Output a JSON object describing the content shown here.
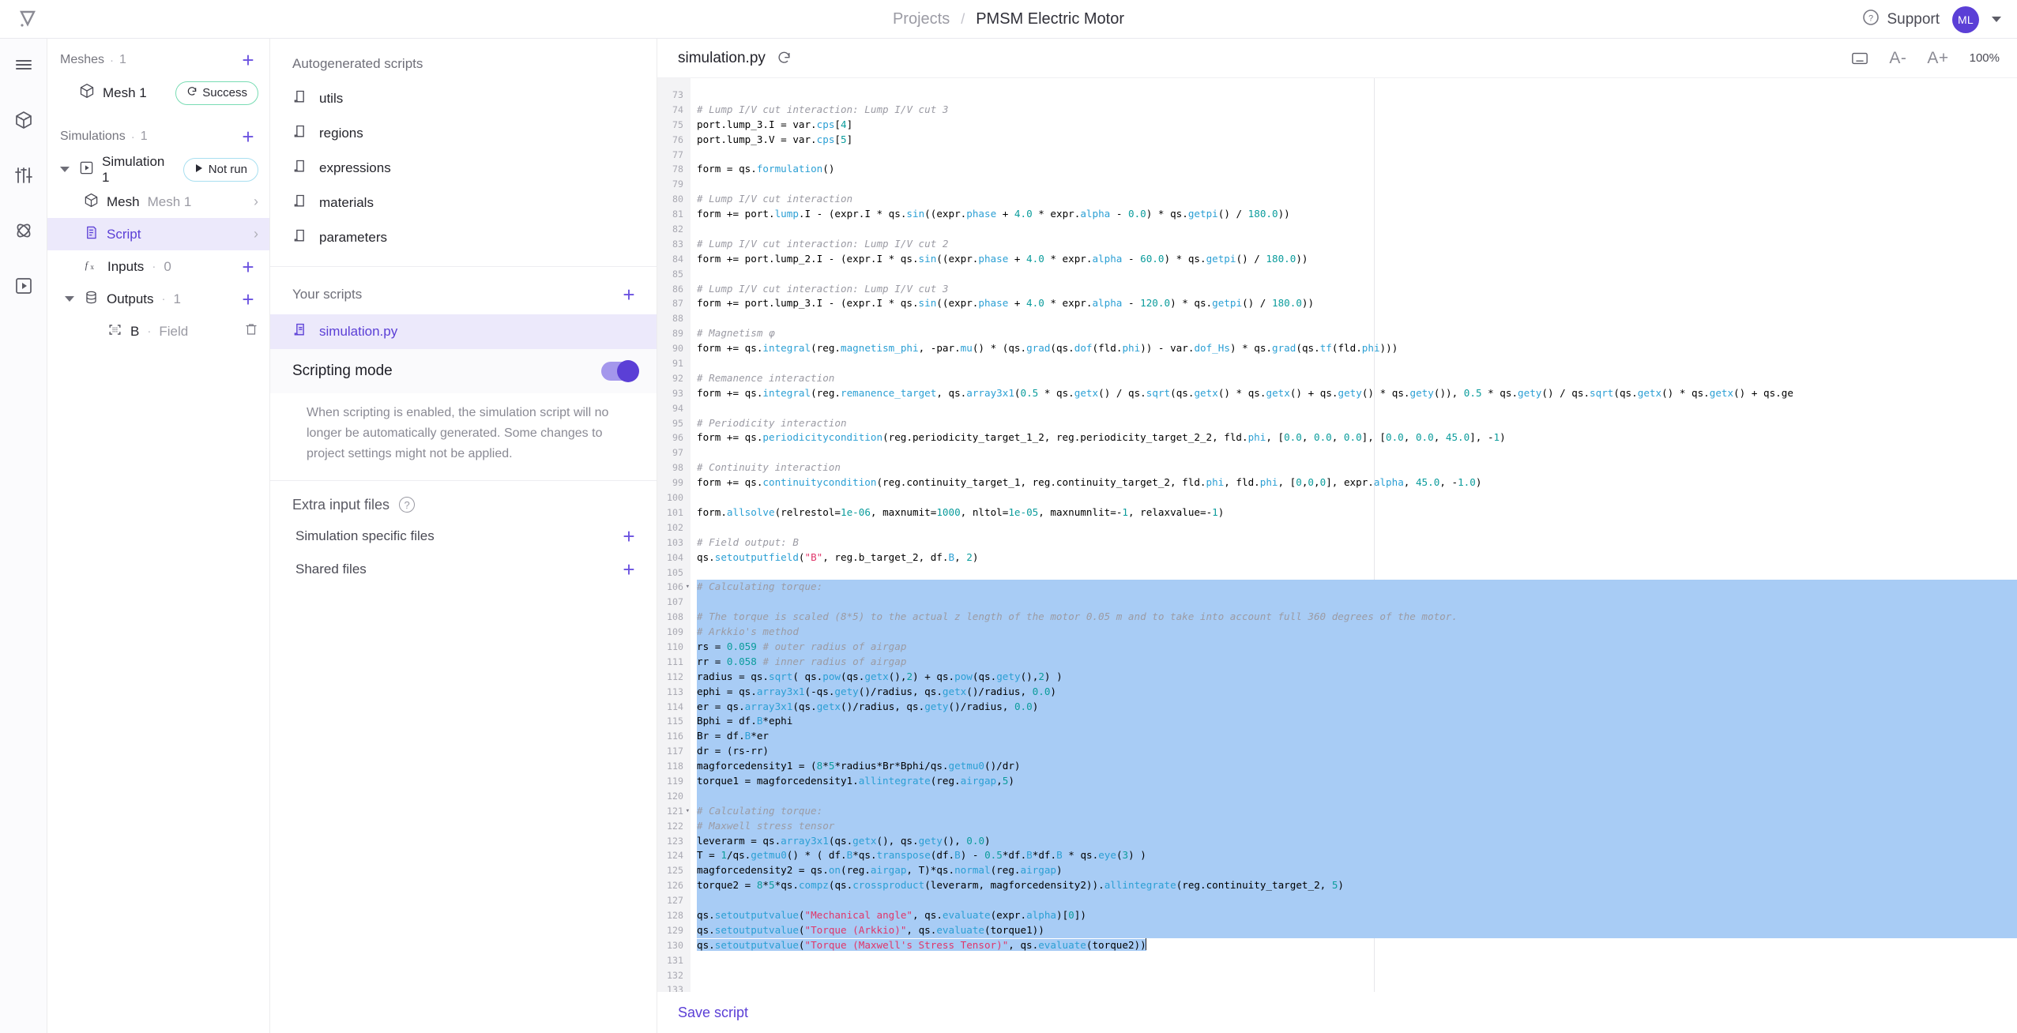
{
  "topbar": {
    "logo_icon": "quanscient-logo-icon",
    "breadcrumb": {
      "root": "Projects",
      "separator": "/",
      "current": "PMSM Electric Motor"
    },
    "support_label": "Support",
    "support_icon": "question-circle-icon",
    "avatar_initials": "ML",
    "chevron_icon": "chevron-down-icon"
  },
  "rail": {
    "items": [
      {
        "icon": "hamburger-menu-icon",
        "name": "menu"
      },
      {
        "icon": "geometry-cube-icon",
        "name": "geometry"
      },
      {
        "icon": "sliders-icon",
        "name": "physics-settings"
      },
      {
        "icon": "atom-icon",
        "name": "materials"
      },
      {
        "icon": "play-box-icon",
        "name": "simulations"
      }
    ]
  },
  "tree": {
    "meshes": {
      "label": "Meshes",
      "sep": "·",
      "count": "1",
      "add_icon": "plus-icon"
    },
    "mesh_item": {
      "icon": "cube-icon",
      "label": "Mesh 1",
      "status": "Success",
      "status_icon": "refresh-icon"
    },
    "simulations": {
      "label": "Simulations",
      "sep": "·",
      "count": "1",
      "add_icon": "plus-icon"
    },
    "simulation_item": {
      "icon": "play-box-icon",
      "label": "Simulation 1",
      "status": "Not run",
      "status_icon": "play-triangle-icon"
    },
    "children": [
      {
        "icon": "cube-icon",
        "label": "Mesh",
        "sub": "Mesh 1",
        "chevron": "chevron-right-icon",
        "selected": false
      },
      {
        "icon": "script-icon",
        "label": "Script",
        "sub": "",
        "chevron": "chevron-right-icon",
        "selected": true
      }
    ],
    "inputs": {
      "icon": "fx-icon",
      "label": "Inputs",
      "sep": "·",
      "count": "0",
      "add_icon": "plus-icon"
    },
    "outputs": {
      "icon": "database-icon",
      "label": "Outputs",
      "sep": "·",
      "count": "1",
      "add_icon": "plus-icon"
    },
    "output_items": [
      {
        "icon": "field-select-icon",
        "label": "B",
        "sep": "·",
        "type": "Field",
        "delete_icon": "trash-icon"
      }
    ]
  },
  "scripts_panel": {
    "autogen_heading": "Autogenerated scripts",
    "autogen_items": [
      {
        "icon": "script-file-icon",
        "label": "utils"
      },
      {
        "icon": "script-file-icon",
        "label": "regions"
      },
      {
        "icon": "script-file-icon",
        "label": "expressions"
      },
      {
        "icon": "script-file-icon",
        "label": "materials"
      },
      {
        "icon": "script-file-icon",
        "label": "parameters"
      }
    ],
    "your_scripts_heading": "Your scripts",
    "your_scripts_add_icon": "plus-icon",
    "your_scripts_items": [
      {
        "icon": "script-file-icon",
        "label": "simulation.py",
        "selected": true
      }
    ],
    "scripting_mode": {
      "label": "Scripting mode",
      "enabled": true,
      "description": "When scripting is enabled, the simulation script will no longer be automatically generated. Some changes to project settings might not be applied."
    },
    "extra_input_files": {
      "heading": "Extra input files",
      "help_icon": "question-circle-icon",
      "rows": [
        {
          "label": "Simulation specific files",
          "add_icon": "plus-icon"
        },
        {
          "label": "Shared files",
          "add_icon": "plus-icon"
        }
      ]
    }
  },
  "editor": {
    "file_name": "simulation.py",
    "refresh_icon": "refresh-icon",
    "keyboard_icon": "keyboard-icon",
    "font_decrease_label": "A-",
    "font_increase_label": "A+",
    "zoom_level": "100%",
    "save_label": "Save script",
    "first_line_number": 73,
    "last_line_number": 133,
    "selection_start_line": 106,
    "selection_end_line": 130,
    "fold_lines": [
      106,
      121
    ],
    "accent_color": "#5b3fd6",
    "selection_color": "#a8ccf5",
    "lines": [
      "",
      "# Lump I/V cut interaction: Lump I/V cut 3",
      "port.lump_3.I = var.cps[4]",
      "port.lump_3.V = var.cps[5]",
      "",
      "form = qs.formulation()",
      "",
      "# Lump I/V cut interaction",
      "form += port.lump.I - (expr.I * qs.sin((expr.phase + 4.0 * expr.alpha - 0.0) * qs.getpi() / 180.0))",
      "",
      "# Lump I/V cut interaction: Lump I/V cut 2",
      "form += port.lump_2.I - (expr.I * qs.sin((expr.phase + 4.0 * expr.alpha - 60.0) * qs.getpi() / 180.0))",
      "",
      "# Lump I/V cut interaction: Lump I/V cut 3",
      "form += port.lump_3.I - (expr.I * qs.sin((expr.phase + 4.0 * expr.alpha - 120.0) * qs.getpi() / 180.0))",
      "",
      "# Magnetism φ",
      "form += qs.integral(reg.magnetism_phi, -par.mu() * (qs.grad(qs.dof(fld.phi)) - var.dof_Hs) * qs.grad(qs.tf(fld.phi)))",
      "",
      "# Remanence interaction",
      "form += qs.integral(reg.remanence_target, qs.array3x1(0.5 * qs.getx() / qs.sqrt(qs.getx() * qs.getx() + qs.gety() * qs.gety()), 0.5 * qs.gety() / qs.sqrt(qs.getx() * qs.getx() + qs.ge",
      "",
      "# Periodicity interaction",
      "form += qs.periodicitycondition(reg.periodicity_target_1_2, reg.periodicity_target_2_2, fld.phi, [0.0, 0.0, 0.0], [0.0, 0.0, 45.0], -1)",
      "",
      "# Continuity interaction",
      "form += qs.continuitycondition(reg.continuity_target_1, reg.continuity_target_2, fld.phi, fld.phi, [0,0,0], expr.alpha, 45.0, -1.0)",
      "",
      "form.allsolve(relrestol=1e-06, maxnumit=1000, nltol=1e-05, maxnumnlit=-1, relaxvalue=-1)",
      "",
      "# Field output: B",
      "qs.setoutputfield(\"B\", reg.b_target_2, df.B, 2)",
      "",
      "# Calculating torque:",
      "",
      "# The torque is scaled (8*5) to the actual z length of the motor 0.05 m and to take into account full 360 degrees of the motor.",
      "# Arkkio's method",
      "rs = 0.059 # outer radius of airgap",
      "rr = 0.058 # inner radius of airgap",
      "radius = qs.sqrt( qs.pow(qs.getx(),2) + qs.pow(qs.gety(),2) )",
      "ephi = qs.array3x1(-qs.gety()/radius, qs.getx()/radius, 0.0)",
      "er = qs.array3x1(qs.getx()/radius, qs.gety()/radius, 0.0)",
      "Bphi = df.B*ephi",
      "Br = df.B*er",
      "dr = (rs-rr)",
      "magforcedensity1 = (8*5*radius*Br*Bphi/qs.getmu0()/dr)",
      "torque1 = magforcedensity1.allintegrate(reg.airgap,5)",
      "",
      "# Calculating torque:",
      "# Maxwell stress tensor",
      "leverarm = qs.array3x1(qs.getx(), qs.gety(), 0.0)",
      "T = 1/qs.getmu0() * ( df.B*qs.transpose(df.B) - 0.5*df.B*df.B * qs.eye(3) )",
      "magforcedensity2 = qs.on(reg.airgap, T)*qs.normal(reg.airgap)",
      "torque2 = 8*5*qs.compz(qs.crossproduct(leverarm, magforcedensity2)).allintegrate(reg.continuity_target_2, 5)",
      "",
      "qs.setoutputvalue(\"Mechanical angle\", qs.evaluate(expr.alpha)[0])",
      "qs.setoutputvalue(\"Torque (Arkkio)\", qs.evaluate(torque1))",
      "qs.setoutputvalue(\"Torque (Maxwell's Stress Tensor)\", qs.evaluate(torque2))",
      "",
      "",
      ""
    ]
  }
}
